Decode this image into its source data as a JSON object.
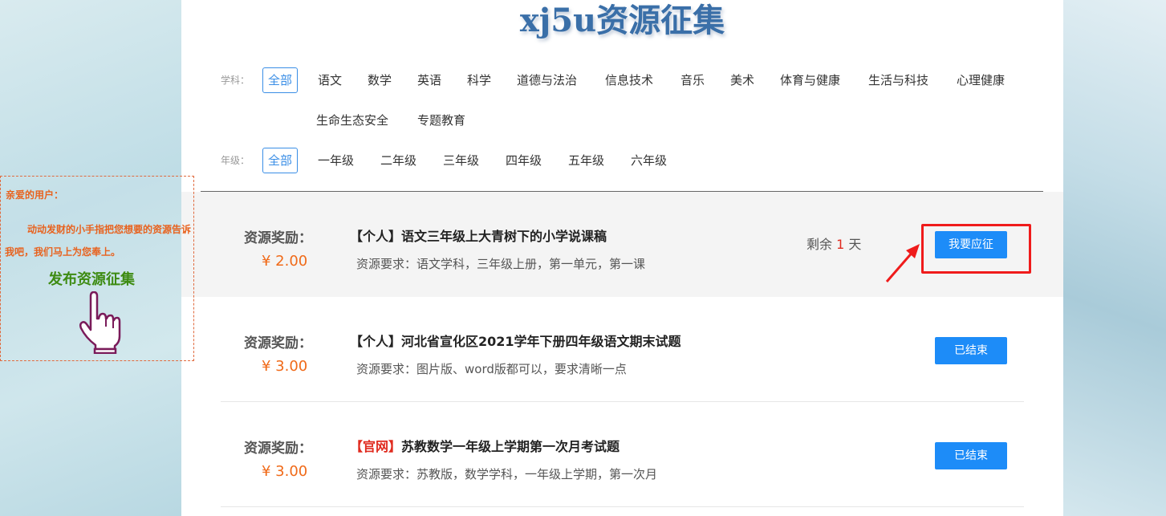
{
  "page": {
    "title": "xj5u资源征集"
  },
  "filters": {
    "subject": {
      "label": "学科：",
      "items": [
        "全部",
        "语文",
        "数学",
        "英语",
        "科学",
        "道德与法治",
        "信息技术",
        "音乐",
        "美术",
        "体育与健康",
        "生活与科技",
        "心理健康",
        "生命生态安全",
        "专题教育"
      ],
      "selected": "全部"
    },
    "grade": {
      "label": "年级：",
      "items": [
        "全部",
        "一年级",
        "二年级",
        "三年级",
        "四年级",
        "五年级",
        "六年级"
      ],
      "selected": "全部"
    }
  },
  "resources": [
    {
      "reward_label": "资源奖励：",
      "reward": "¥ 2.00",
      "tag": "【个人】",
      "tag_color": "#222222",
      "title": "语文三年级上大青树下的小学说课稿",
      "requirement": "资源要求：语文学科，三年级上册，第一单元，第一课",
      "remaining_prefix": "剩余",
      "remaining_days": "1",
      "remaining_suffix": "天",
      "button": "我要应征",
      "highlighted": true
    },
    {
      "reward_label": "资源奖励：",
      "reward": "¥ 3.00",
      "tag": "【个人】",
      "tag_color": "#222222",
      "title": "河北省宣化区2021学年下册四年级语文期末试题",
      "requirement": "资源要求：图片版、word版都可以，要求清晰一点",
      "button": "已结束"
    },
    {
      "reward_label": "资源奖励：",
      "reward": "¥ 3.00",
      "tag": "【官网】",
      "tag_color": "#e02b1f",
      "title": "苏教数学一年级上学期第一次月考试题",
      "requirement": "资源要求：苏教版，数学学科，一年级上学期，第一次月",
      "button": "已结束"
    }
  ],
  "side_card": {
    "greeting": "亲爱的用户：",
    "message": "动动发财的小手指把您想要的资源告诉我吧，我们马上为您奉上。",
    "link": "发布资源征集",
    "icon": "hand-pointer-icon"
  },
  "colors": {
    "primary_button": "#1d8cf8",
    "price": "#f06a19",
    "highlight_border": "#ef1b1b",
    "side_text": "#e8621e",
    "side_link": "#3d8b12",
    "title": "#3a6fa8"
  }
}
